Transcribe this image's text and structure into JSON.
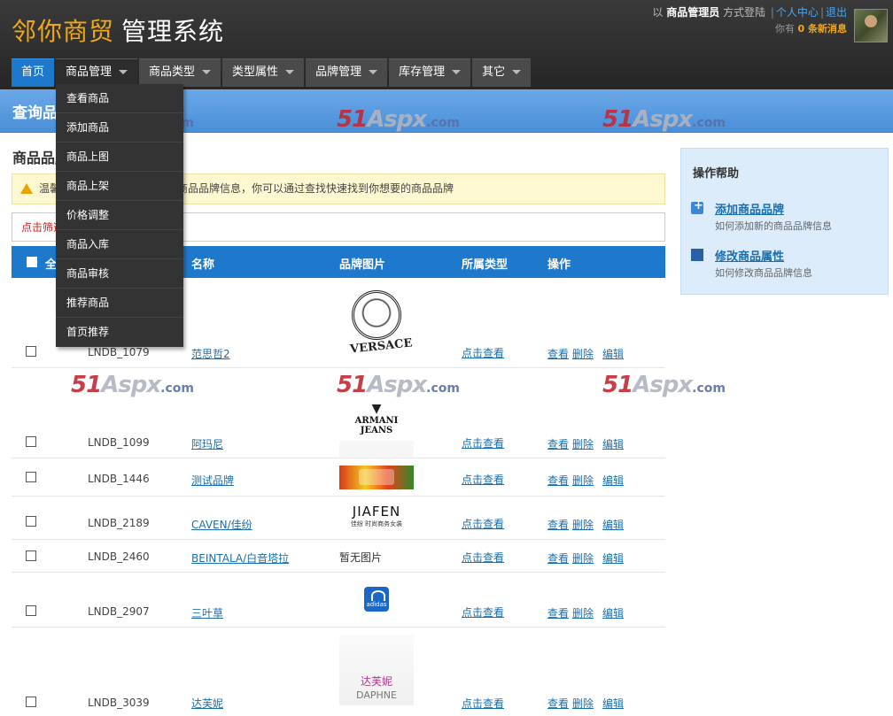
{
  "header": {
    "brand": "邻你商贸",
    "system_name": "管理系统",
    "prefix": "以",
    "role": "商品管理员",
    "login_mode": "方式登陆",
    "profile_link": "个人中心",
    "separator": "|",
    "logout_link": "退出",
    "msg_prefix": "你有",
    "msg_count": "0 条新消息"
  },
  "nav": {
    "items": [
      {
        "label": "首页"
      },
      {
        "label": "商品管理"
      },
      {
        "label": "商品类型"
      },
      {
        "label": "类型属性"
      },
      {
        "label": "品牌管理"
      },
      {
        "label": "库存管理"
      },
      {
        "label": "其它"
      }
    ]
  },
  "dropdown": {
    "items": [
      "查看商品",
      "添加商品",
      "商品上图",
      "商品上架",
      "价格调整",
      "商品入库",
      "商品审核",
      "推荐商品",
      "首页推荐"
    ]
  },
  "titlebar": {
    "title": "查询品牌"
  },
  "watermark": {
    "num": "51",
    "mid": "Aspx",
    "dom": ".com"
  },
  "content": {
    "section_title": "商品品牌",
    "tip": "温馨提示：这里列出了所有的商品品牌信息，你可以通过查找快速找到你想要的商品品牌",
    "filter": "点击筛选"
  },
  "table": {
    "headers": {
      "select_all": "全选",
      "name": "名称",
      "image": "品牌图片",
      "type": "所属类型",
      "ops": "操作"
    },
    "type_link": "点击查看",
    "op_view": "查看",
    "op_delete": "删除",
    "op_edit": "编辑",
    "no_image": "暂无图片",
    "rows": [
      {
        "code": "LNDB_1079",
        "name": "范思哲2",
        "logo": "versace",
        "logo_text": "VERSACE"
      },
      {
        "code": "LNDB_1099",
        "name": "阿玛尼",
        "logo": "armani",
        "logo_text": "ARMANI JEANS"
      },
      {
        "code": "LNDB_1446",
        "name": "测试品牌",
        "logo": "test"
      },
      {
        "code": "LNDB_2189",
        "name": "CAVEN/佳纷",
        "logo": "jiafen",
        "logo_text": "JIAFEN",
        "logo_sub": "佳纷 时尚商务女装"
      },
      {
        "code": "LNDB_2460",
        "name": "BEINTALA/白音塔拉",
        "logo": "none"
      },
      {
        "code": "LNDB_2907",
        "name": "三叶草",
        "logo": "adidas",
        "logo_text": "adidas"
      },
      {
        "code": "LNDB_3039",
        "name": "达芙妮",
        "logo": "daphne",
        "logo_text": "达芙妮",
        "logo_sub": "DAPHNE"
      }
    ]
  },
  "help": {
    "title": "操作帮助",
    "items": [
      {
        "label": "添加商品品牌",
        "desc": "如何添加新的商品品牌信息"
      },
      {
        "label": "修改商品属性",
        "desc": "如何修改商品品牌信息"
      }
    ]
  },
  "colors": {
    "accent": "#1e78cc",
    "brand": "#f0a818",
    "watermark": "#c22a36"
  }
}
